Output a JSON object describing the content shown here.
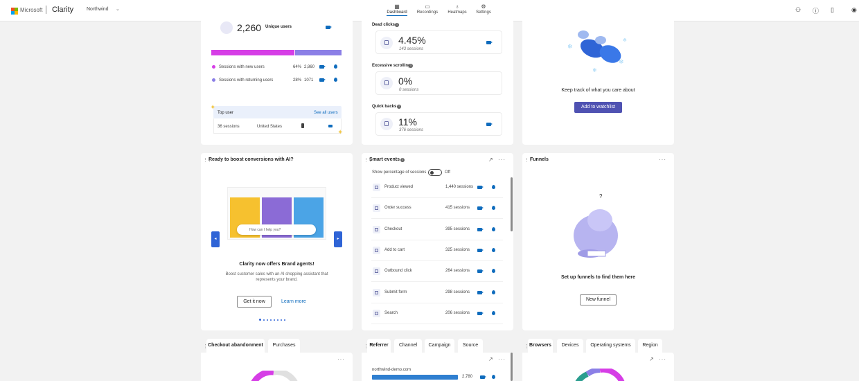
{
  "header": {
    "ms_label": "Microsoft",
    "brand": "Clarity",
    "project": "Northwind",
    "nav": [
      {
        "label": "Dashboard",
        "icon": "dashboard-icon"
      },
      {
        "label": "Recordings",
        "icon": "recordings-icon"
      },
      {
        "label": "Heatmaps",
        "icon": "heatmaps-icon"
      },
      {
        "label": "Settings",
        "icon": "settings-icon"
      }
    ],
    "logo_colors": [
      "#f25022",
      "#7fba00",
      "#00a4ef",
      "#ffb900"
    ]
  },
  "users": {
    "count": "2,260",
    "label": "Unique users",
    "new_pct": 0.64,
    "bar_colors": [
      "#d63ee6",
      "#8b7fe6"
    ],
    "rows": [
      {
        "label": "Sessions with new users",
        "pct": "64%",
        "count": "2,860"
      },
      {
        "label": "Sessions with returning users",
        "pct": "28%",
        "count": "1071"
      }
    ],
    "top_user_label": "Top user",
    "see_all": "See all users",
    "top_sessions": "36 sessions",
    "top_country": "United States"
  },
  "insights": {
    "items": [
      {
        "title": "Dead clicks",
        "value": "4.45%",
        "sub": "143 sessions"
      },
      {
        "title": "Excessive scrolling",
        "value": "0%",
        "sub": "0 sessions"
      },
      {
        "title": "Quick backs",
        "value": "11%",
        "sub": "376 sessions"
      }
    ]
  },
  "watchlist": {
    "text": "Keep track of what you care about",
    "button": "Add to watchlist"
  },
  "ai": {
    "title": "Ready to boost conversions with AI?",
    "chat_placeholder": "How can I help you?",
    "headline": "Clarity now offers Brand agents!",
    "body1": "Boost customer sales with an AI shopping assistant that",
    "body2": "represents your brand.",
    "cta": "Get it now",
    "learn": "Learn more"
  },
  "smart_events": {
    "title": "Smart events",
    "toggle_label": "Show percentage of sessions",
    "toggle_state": "Off",
    "events": [
      {
        "name": "Product viewed",
        "sessions": "1,440 sessions"
      },
      {
        "name": "Order success",
        "sessions": "415 sessions"
      },
      {
        "name": "Checkout",
        "sessions": "395 sessions"
      },
      {
        "name": "Add to cart",
        "sessions": "325 sessions"
      },
      {
        "name": "Outbound click",
        "sessions": "264 sessions"
      },
      {
        "name": "Submit form",
        "sessions": "298 sessions"
      },
      {
        "name": "Search",
        "sessions": "206 sessions"
      }
    ]
  },
  "funnels": {
    "title": "Funnels",
    "text": "Set up funnels to find them here",
    "button": "New funnel"
  },
  "bottom": {
    "checkout_tabs": [
      "Checkout abandonment",
      "Purchases"
    ],
    "referrer_tabs": [
      "Referrer",
      "Channel",
      "Campaign",
      "Source"
    ],
    "browser_tabs": [
      "Browsers",
      "Devices",
      "Operating systems",
      "Region"
    ],
    "referrer_domain": "northwind-demo.com",
    "referrer_count": "2,780"
  }
}
